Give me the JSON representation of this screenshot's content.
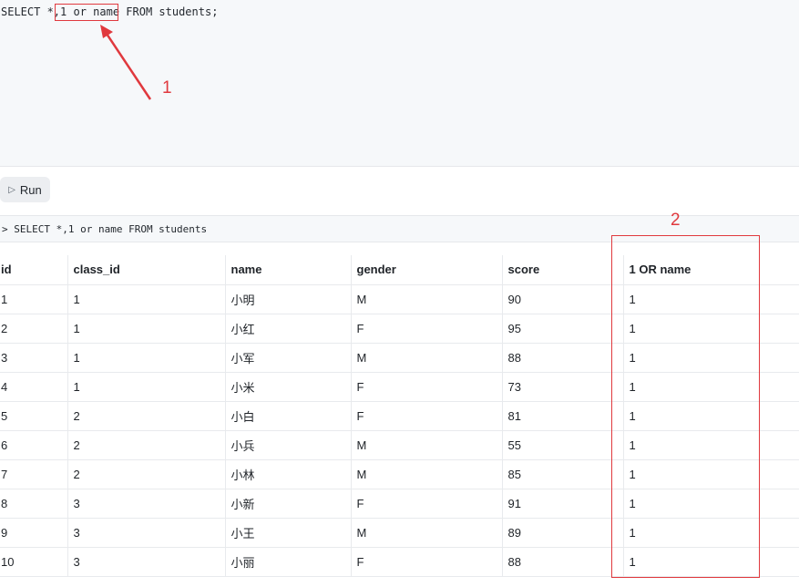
{
  "editor": {
    "code_prefix": "SELECT *,",
    "code_highlight": "1 or name",
    "code_suffix": " FROM students;"
  },
  "toolbar": {
    "run_icon": "play-icon",
    "run_label": "Run"
  },
  "query_echo": "> SELECT *,1 or name FROM students",
  "table": {
    "columns": [
      "id",
      "class_id",
      "name",
      "gender",
      "score",
      "1 OR name"
    ],
    "rows": [
      [
        "1",
        "1",
        "小明",
        "M",
        "90",
        "1"
      ],
      [
        "2",
        "1",
        "小红",
        "F",
        "95",
        "1"
      ],
      [
        "3",
        "1",
        "小军",
        "M",
        "88",
        "1"
      ],
      [
        "4",
        "1",
        "小米",
        "F",
        "73",
        "1"
      ],
      [
        "5",
        "2",
        "小白",
        "F",
        "81",
        "1"
      ],
      [
        "6",
        "2",
        "小兵",
        "M",
        "55",
        "1"
      ],
      [
        "7",
        "2",
        "小林",
        "M",
        "85",
        "1"
      ],
      [
        "8",
        "3",
        "小新",
        "F",
        "91",
        "1"
      ],
      [
        "9",
        "3",
        "小王",
        "M",
        "89",
        "1"
      ],
      [
        "10",
        "3",
        "小丽",
        "F",
        "88",
        "1"
      ]
    ]
  },
  "annotations": {
    "label_1": "1",
    "label_2": "2",
    "color": "#e0393e"
  }
}
